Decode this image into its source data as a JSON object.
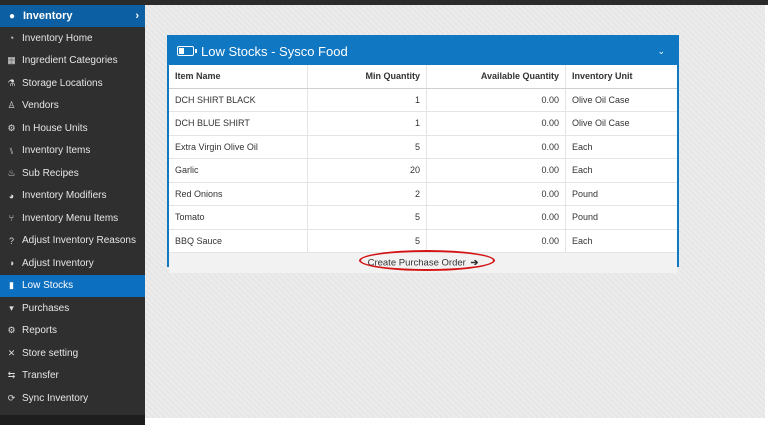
{
  "sidebar": {
    "title": "Inventory",
    "items": [
      {
        "label": "Inventory Home",
        "icon": "dashboard-icon"
      },
      {
        "label": "Ingredient Categories",
        "icon": "grid-icon"
      },
      {
        "label": "Storage Locations",
        "icon": "flask-icon"
      },
      {
        "label": "Vendors",
        "icon": "user-icon"
      },
      {
        "label": "In House Units",
        "icon": "cogs-icon"
      },
      {
        "label": "Inventory Items",
        "icon": "cutlery-icon"
      },
      {
        "label": "Sub Recipes",
        "icon": "kitchen-icon"
      },
      {
        "label": "Inventory Modifiers",
        "icon": "pie-chart-icon"
      },
      {
        "label": "Inventory Menu Items",
        "icon": "fork-knife-icon"
      },
      {
        "label": "Adjust Inventory Reasons",
        "icon": "question-icon"
      },
      {
        "label": "Adjust Inventory",
        "icon": "half-circle-icon"
      },
      {
        "label": "Low Stocks",
        "icon": "battery-icon",
        "active": true
      },
      {
        "label": "Purchases",
        "icon": "cart-icon"
      },
      {
        "label": "Reports",
        "icon": "cogs-icon"
      },
      {
        "label": "Store setting",
        "icon": "wrench-icon"
      },
      {
        "label": "Transfer",
        "icon": "exchange-icon"
      },
      {
        "label": "Sync Inventory",
        "icon": "sync-icon"
      }
    ]
  },
  "panel": {
    "title": "Low Stocks - Sysco Food",
    "columns": [
      "Item Name",
      "Min Quantity",
      "Available Quantity",
      "Inventory Unit"
    ],
    "rows": [
      [
        "DCH SHIRT BLACK",
        "1",
        "0.00",
        "Olive Oil Case"
      ],
      [
        "DCH BLUE SHIRT",
        "1",
        "0.00",
        "Olive Oil Case"
      ],
      [
        "Extra Virgin Olive Oil",
        "5",
        "0.00",
        "Each"
      ],
      [
        "Garlic",
        "20",
        "0.00",
        "Each"
      ],
      [
        "Red Onions",
        "2",
        "0.00",
        "Pound"
      ],
      [
        "Tomato",
        "5",
        "0.00",
        "Pound"
      ],
      [
        "BBQ Sauce",
        "5",
        "0.00",
        "Each"
      ]
    ],
    "cta_label": "Create Purchase Order",
    "cta_arrow": "➔",
    "highlight_color": "#d41414"
  },
  "colors": {
    "accent": "#1077c2",
    "sidebar_bg": "#2f2f2f",
    "active_item": "#0d6fbf"
  }
}
